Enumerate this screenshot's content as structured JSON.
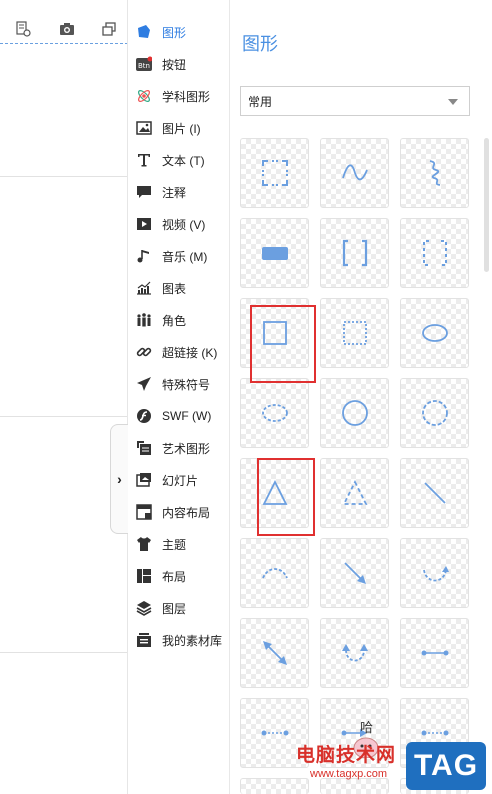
{
  "menu": {
    "items": [
      {
        "label": "图形",
        "icon": "shape-icon",
        "active": true
      },
      {
        "label": "按钮",
        "icon": "button-icon"
      },
      {
        "label": "学科图形",
        "icon": "atom-icon"
      },
      {
        "label": "图片 (I)",
        "icon": "image-icon"
      },
      {
        "label": "文本 (T)",
        "icon": "text-icon"
      },
      {
        "label": "注释",
        "icon": "comment-icon"
      },
      {
        "label": "视频 (V)",
        "icon": "video-icon"
      },
      {
        "label": "音乐 (M)",
        "icon": "music-icon"
      },
      {
        "label": "图表",
        "icon": "chart-icon"
      },
      {
        "label": "角色",
        "icon": "people-icon"
      },
      {
        "label": "超链接 (K)",
        "icon": "link-icon"
      },
      {
        "label": "特殊符号",
        "icon": "plane-icon"
      },
      {
        "label": "SWF (W)",
        "icon": "flash-icon"
      },
      {
        "label": "艺术图形",
        "icon": "art-icon"
      },
      {
        "label": "幻灯片",
        "icon": "slide-icon"
      },
      {
        "label": "内容布局",
        "icon": "content-layout-icon"
      },
      {
        "label": "主题",
        "icon": "shirt-icon"
      },
      {
        "label": "布局",
        "icon": "layout-icon"
      },
      {
        "label": "图层",
        "icon": "layers-icon"
      },
      {
        "label": "我的素材库",
        "icon": "library-icon"
      }
    ]
  },
  "panel": {
    "title": "图形",
    "category_value": "常用",
    "shapes": [
      "dashed-rect-corners-icon",
      "wave-line-icon",
      "curly-line-icon",
      "filled-rect-icon",
      "square-brackets-icon",
      "dashed-brackets-icon",
      "square-outline-icon",
      "dotted-square-icon",
      "ellipse-outline-icon",
      "dashed-ellipse-icon",
      "circle-outline-icon",
      "dashed-circle-icon",
      "triangle-outline-icon",
      "dashed-triangle-icon",
      "diagonal-line-icon",
      "dashed-arc-icon",
      "arrow-diagonal-icon",
      "dashed-curved-arrow-icon",
      "double-arrow-diagonal-icon",
      "u-turn-arrow-icon",
      "dot-line-dot-icon",
      "dashed-dot-line-icon",
      "line-arrow-icon",
      "dashed-dot-line-icon"
    ]
  },
  "watermark": {
    "text": "电脑技术网",
    "url": "www.tagxp.com",
    "tag": "TAG"
  },
  "colors": {
    "accent": "#4a90e2",
    "shape_stroke": "#6b9fe0",
    "highlight": "#e03030"
  }
}
